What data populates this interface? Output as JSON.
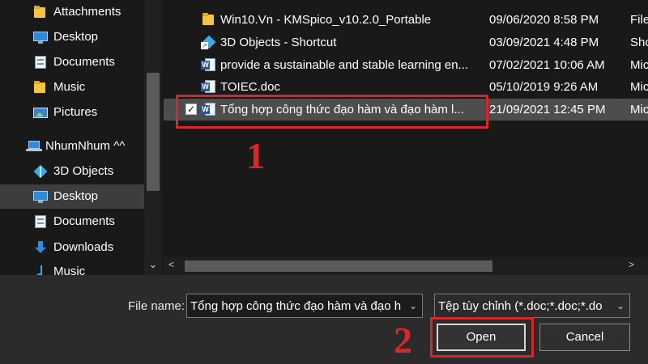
{
  "sidebar": {
    "items": [
      {
        "label": "Attachments",
        "icon": "folder-icon"
      },
      {
        "label": "Desktop",
        "icon": "monitor-icon"
      },
      {
        "label": "Documents",
        "icon": "document-icon"
      },
      {
        "label": "Music",
        "icon": "folder-icon"
      },
      {
        "label": "Pictures",
        "icon": "pictures-icon"
      },
      {
        "label": "NhumNhum ^^",
        "icon": "laptop-icon"
      },
      {
        "label": "3D Objects",
        "icon": "cube-icon"
      },
      {
        "label": "Desktop",
        "icon": "monitor-icon",
        "selected": true
      },
      {
        "label": "Documents",
        "icon": "document-icon"
      },
      {
        "label": "Downloads",
        "icon": "download-arrow-icon"
      },
      {
        "label": "Music",
        "icon": "music-note-icon"
      }
    ],
    "scroll_down_glyph": "⌄"
  },
  "files": [
    {
      "name": "Win10.Vn - KMSpico_v10.2.0_Portable",
      "date": "09/06/2020 8:58 PM",
      "type": "File",
      "icon": "folder-icon"
    },
    {
      "name": "3D Objects - Shortcut",
      "date": "03/09/2021 4:48 PM",
      "type": "Sho",
      "icon": "cube-shortcut-icon"
    },
    {
      "name": "provide a sustainable and stable learning en...",
      "date": "07/02/2021 10:06 AM",
      "type": "Mic",
      "icon": "word-doc-icon"
    },
    {
      "name": "TOIEC.doc",
      "date": "05/10/2019 9:26 AM",
      "type": "Mic",
      "icon": "word-doc-icon"
    },
    {
      "name": "Tổng hợp công thức đạo hàm và đạo hàm l...",
      "date": "21/09/2021 12:45 PM",
      "type": "Mic",
      "icon": "word-doc-icon",
      "selected": true,
      "check": "✓"
    }
  ],
  "hscroll": {
    "left_glyph": "<",
    "right_glyph": ">"
  },
  "bottom": {
    "file_name_label": "File name:",
    "file_name_value": "Tổng hợp công thức đạo hàm và đạo h",
    "file_type_value": "Tệp tùy chỉnh (*.doc;*.doc;*.do",
    "chevron": "⌄",
    "open_label": "Open",
    "cancel_label": "Cancel"
  },
  "annotations": {
    "step1": "1",
    "step2": "2",
    "color": "#d7262c"
  },
  "colors": {
    "background": "#191919",
    "selected_row": "#4d4d4d",
    "selected_nav": "#3d3d3d",
    "bottom_bar": "#2b2b2b"
  }
}
